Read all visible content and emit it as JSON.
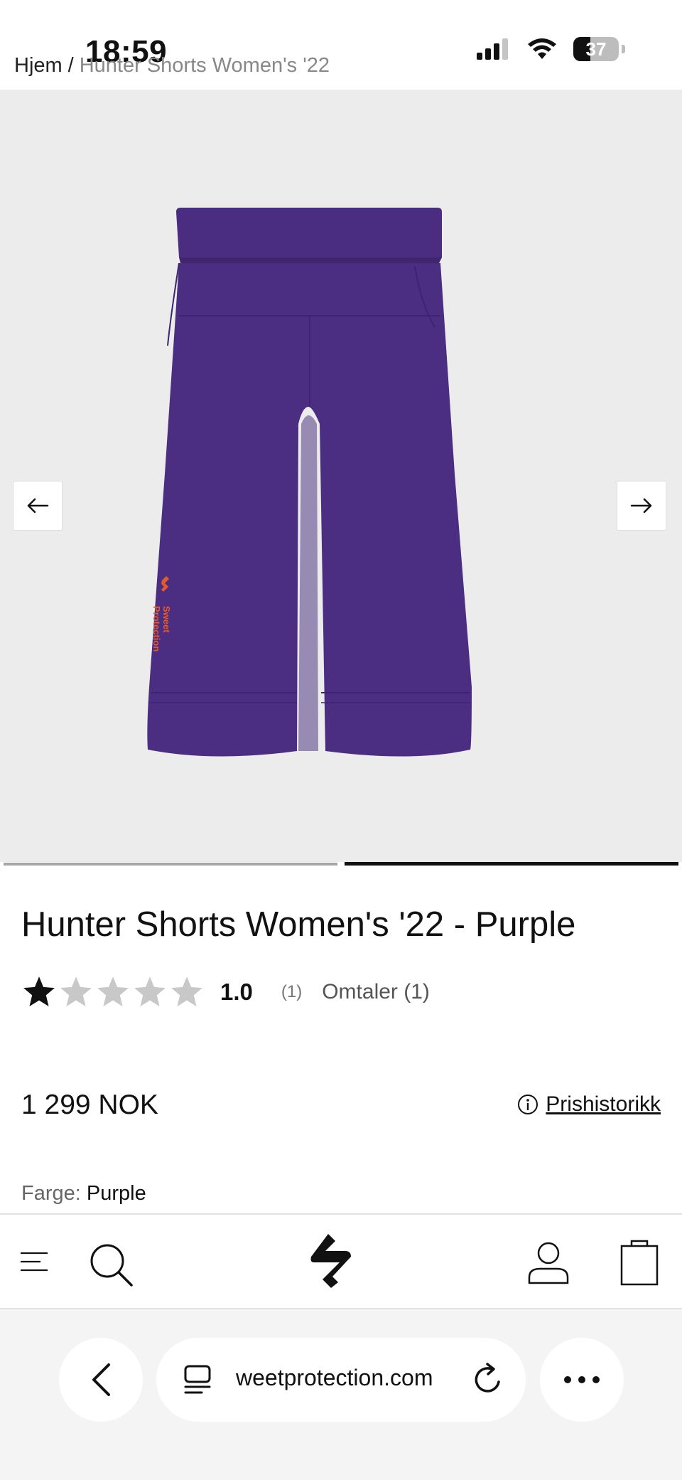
{
  "status_bar": {
    "time": "18:59",
    "battery": "37"
  },
  "breadcrumb": {
    "home": "Hjem",
    "separator": "/",
    "current": "Hunter Shorts Women's '22"
  },
  "gallery": {
    "image_name": "purple-shorts-back-view",
    "logo_text": "Sweet Protection",
    "slide_count": 2,
    "active_slide": 2
  },
  "product": {
    "title": "Hunter Shorts Women's '22 - Purple",
    "rating": 1.0,
    "rating_label": "1.0",
    "rating_max": 5,
    "rating_count": "(1)",
    "reviews_link": "Omtaler (1)",
    "price": "1 299 NOK",
    "price_history": "Prishistorikk",
    "color_label": "Farge:",
    "color_value": "Purple"
  },
  "site_nav": {
    "icons": [
      "menu-icon",
      "search-icon",
      "brand-logo",
      "account-icon",
      "cart-icon"
    ]
  },
  "browser": {
    "url": "weetprotection.com",
    "icons": [
      "back-icon",
      "tabs-icon",
      "reload-icon",
      "more-icon"
    ]
  },
  "colors": {
    "product_purple": "#4b2e82",
    "logo_orange": "#e45a2a",
    "star_filled": "#111111",
    "star_empty": "#c8c8c8"
  }
}
